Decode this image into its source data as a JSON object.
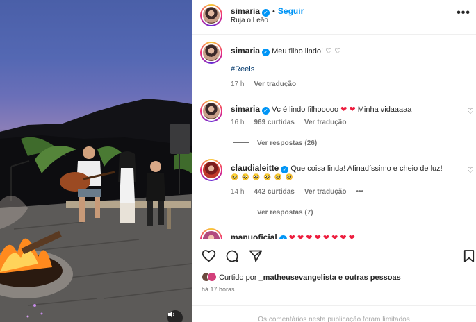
{
  "post": {
    "username": "simaria",
    "follow_label": "Seguir",
    "audio": "Ruja o Leão",
    "caption": "Meu filho lindo!",
    "caption_hearts": "♡ ♡",
    "hashtag": "#Reels",
    "caption_time": "17 h",
    "translate_label": "Ver tradução"
  },
  "comments": [
    {
      "username": "simaria",
      "text": "Vc é lindo filhooooo",
      "hearts": "❤ ❤",
      "tail": "Minha vidaaaaa",
      "time": "16 h",
      "likes": "969 curtidas",
      "translate": "Ver tradução",
      "replies": "Ver respostas (26)"
    },
    {
      "username": "claudialeitte",
      "text": "Que coisa linda! Afinadíssimo e cheio de luz!",
      "emoji": "🥺 🥺 🥺 🥺 🥺 🥺",
      "time": "14 h",
      "likes": "442 curtidas",
      "translate": "Ver tradução",
      "more": "•••",
      "replies": "Ver respostas (7)"
    },
    {
      "username": "manuoficial",
      "hearts": "❤ ❤ ❤ ❤ ❤ ❤ ❤ ❤"
    }
  ],
  "footer": {
    "liked_prefix": "Curtido por",
    "liked_user": "_matheusevangelista",
    "liked_suffix": "e outras pessoas",
    "time": "há 17 horas",
    "limited": "Os comentários nesta publicação foram limitados"
  },
  "colors": {
    "accent": "#0095f6",
    "heart": "#ed1c3d",
    "muted": "#737373"
  }
}
